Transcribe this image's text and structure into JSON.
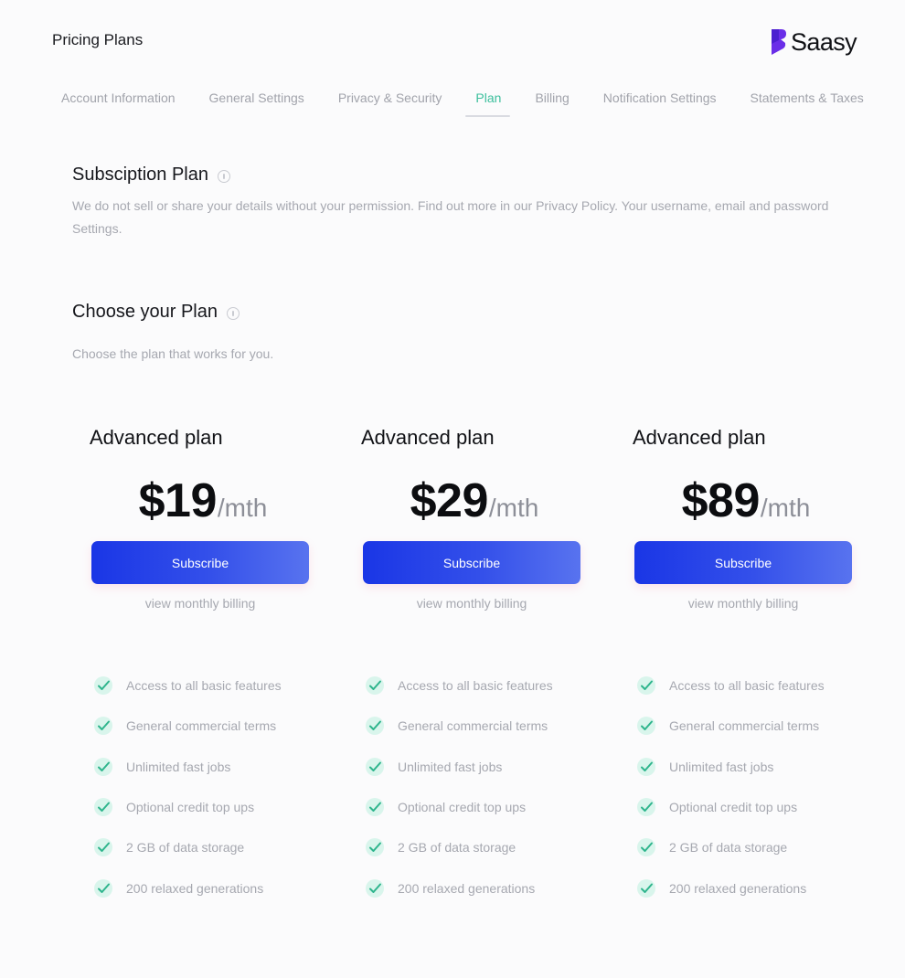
{
  "header": {
    "title": "Pricing Plans",
    "brand": "Saasy",
    "brand_icon": "saasy-logo-mark",
    "brand_color": "#6a2ee8"
  },
  "tabs": [
    {
      "label": "Account Information",
      "active": false
    },
    {
      "label": "General Settings",
      "active": false
    },
    {
      "label": "Privacy & Security",
      "active": false
    },
    {
      "label": "Plan",
      "active": true
    },
    {
      "label": "Billing",
      "active": false
    },
    {
      "label": "Notification Settings",
      "active": false
    },
    {
      "label": "Statements & Taxes",
      "active": false
    }
  ],
  "subscription": {
    "title": "Subsciption Plan",
    "description_line1": "We do not sell or share your details without your permission. Find out more in our Privacy Policy. Your username, email and password",
    "description_line2": "Settings."
  },
  "choose": {
    "title": "Choose your Plan",
    "description": "Choose the plan that works for you."
  },
  "plans": [
    {
      "name": "Advanced plan",
      "price": "$19",
      "unit": "/mth",
      "button": "Subscribe",
      "link": "view monthly billing",
      "features": [
        "Access to all basic features",
        "General commercial terms",
        "Unlimited fast jobs",
        "Optional credit top ups",
        "2 GB of data storage",
        "200 relaxed generations"
      ]
    },
    {
      "name": "Advanced plan",
      "price": "$29",
      "unit": "/mth",
      "button": "Subscribe",
      "link": "view monthly billing",
      "features": [
        "Access to all basic features",
        "General commercial terms",
        "Unlimited fast jobs",
        "Optional credit top ups",
        "2 GB of data storage",
        "200 relaxed generations"
      ]
    },
    {
      "name": "Advanced plan",
      "price": "$89",
      "unit": "/mth",
      "button": "Subscribe",
      "link": "view monthly billing",
      "features": [
        "Access to all basic features",
        "General commercial terms",
        "Unlimited fast jobs",
        "Optional credit top ups",
        "2 GB of data storage",
        "200 relaxed generations"
      ]
    }
  ],
  "colors": {
    "accent": "#3bbf9c",
    "button_start": "#1a36e6",
    "button_end": "#5873ef",
    "check_fill": "#d9f5ec",
    "check_stroke": "#2fb58d"
  }
}
